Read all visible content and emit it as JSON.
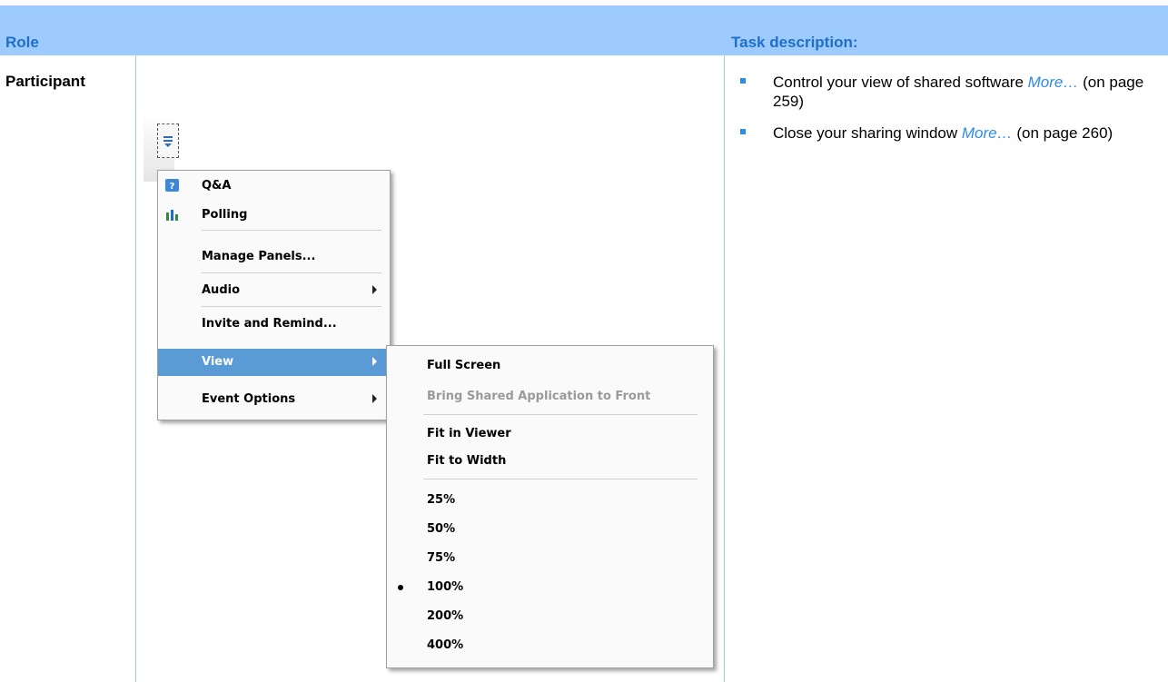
{
  "header": {
    "role": "Role",
    "task": "Task description:"
  },
  "role": "Participant",
  "tasks": [
    {
      "text": "Control your view of shared software ",
      "link": "More…",
      "page": " (on page 259)"
    },
    {
      "text": "Close your sharing window ",
      "link": "More…",
      "page": " (on page 260)"
    }
  ],
  "menu": {
    "items": [
      {
        "label": "Q&A",
        "icon": "qa-icon"
      },
      {
        "label": "Polling",
        "icon": "polling-icon"
      },
      {
        "label": "Manage Panels..."
      },
      {
        "label": "Audio",
        "submenu": true
      },
      {
        "label": "Invite and Remind..."
      },
      {
        "label": "View",
        "submenu": true,
        "selected": true
      },
      {
        "label": "Event Options",
        "submenu": true
      }
    ]
  },
  "submenu": {
    "items": [
      {
        "label": "Full Screen"
      },
      {
        "label": "Bring Shared Application to Front",
        "disabled": true
      },
      {
        "label": "Fit in Viewer"
      },
      {
        "label": "Fit to Width"
      },
      {
        "label": "25%"
      },
      {
        "label": "50%"
      },
      {
        "label": "75%"
      },
      {
        "label": "100%",
        "checked": true
      },
      {
        "label": "200%"
      },
      {
        "label": "400%"
      }
    ]
  },
  "colors": {
    "header_bg": "#9ecbff",
    "header_text": "#1f6fc7",
    "link": "#2c8ce8",
    "menu_selected": "#5b9bd5"
  }
}
